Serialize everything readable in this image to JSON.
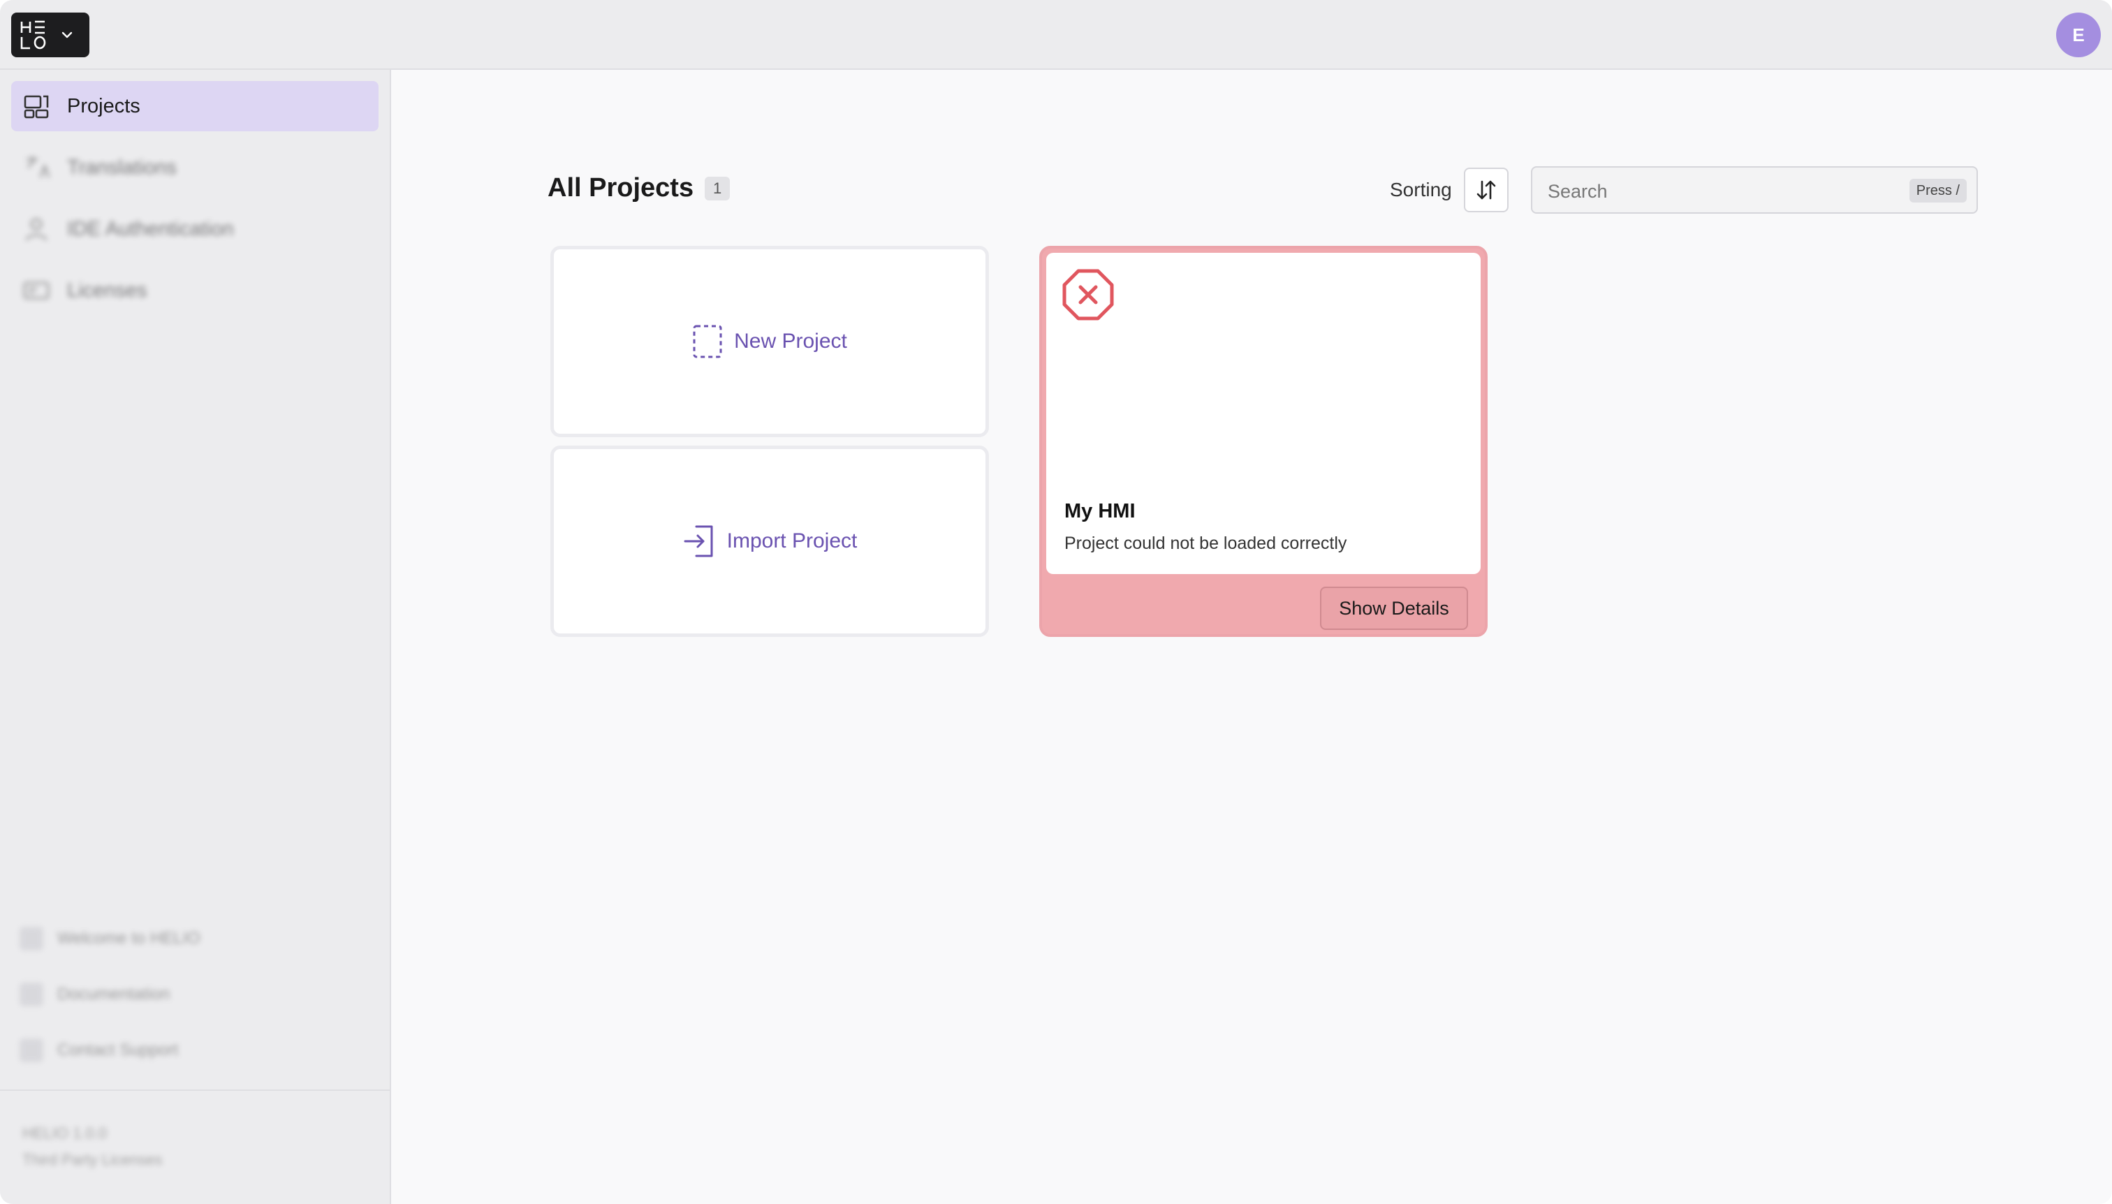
{
  "header": {
    "logo_text": "HELIO",
    "avatar_initial": "E"
  },
  "sidebar": {
    "items": [
      {
        "label": "Projects",
        "icon": "projects-icon",
        "active": true
      },
      {
        "label": "Translations",
        "icon": "translations-icon"
      },
      {
        "label": "IDE Authentication",
        "icon": "user-icon"
      },
      {
        "label": "Licenses",
        "icon": "license-icon"
      }
    ],
    "footer_items": [
      {
        "label": "Welcome to HELIO"
      },
      {
        "label": "Documentation"
      },
      {
        "label": "Contact Support"
      }
    ],
    "version": "HELIO 1.0.0",
    "third_party": "Third Party Licenses"
  },
  "main": {
    "title": "All Projects",
    "count": "1",
    "sorting_label": "Sorting",
    "search_placeholder": "Search",
    "search_shortcut": "Press /",
    "new_project_label": "New Project",
    "import_project_label": "Import Project",
    "project": {
      "name": "My HMI",
      "status": "Project could not be loaded correctly",
      "details_label": "Show Details"
    }
  },
  "colors": {
    "accent": "#6a52b0",
    "active_nav": "#ddd6f3",
    "error": "#e0565e",
    "error_bg": "#f0a9ae",
    "avatar": "#a48ee0"
  }
}
